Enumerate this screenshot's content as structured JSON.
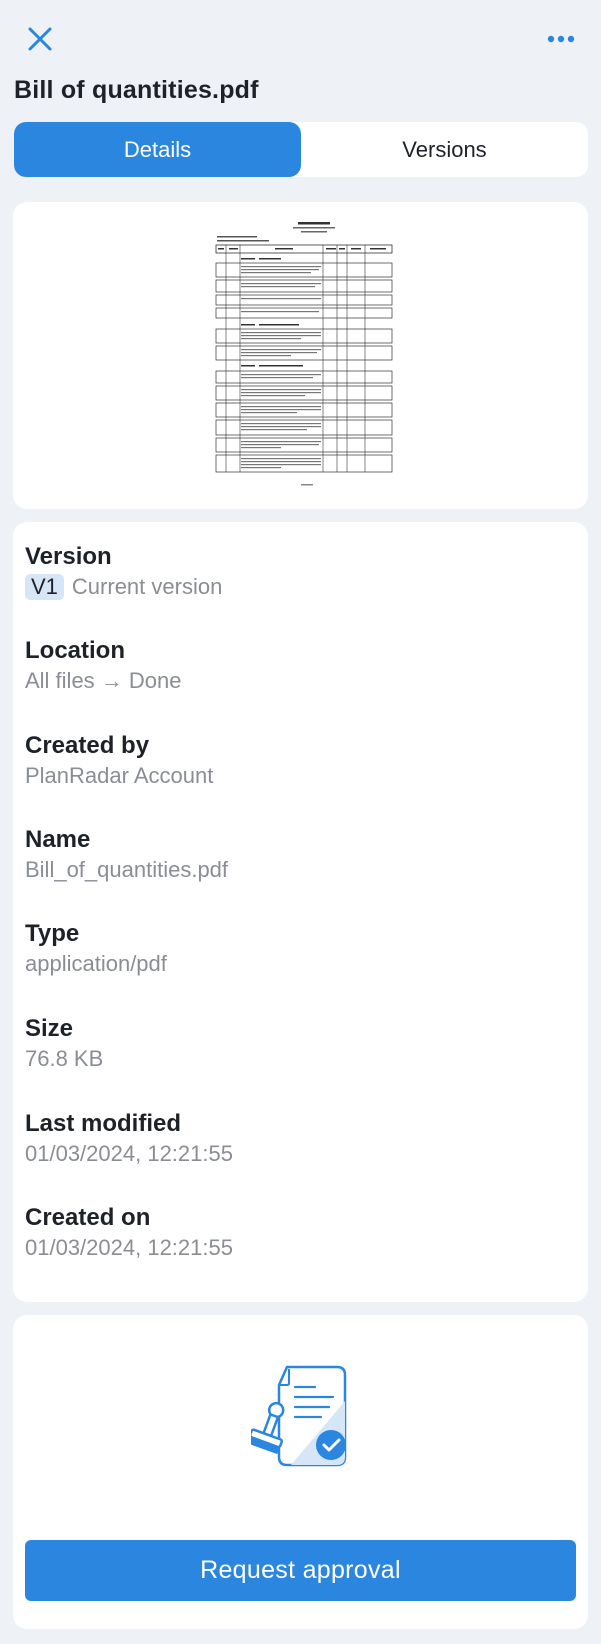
{
  "header": {
    "close_icon": "close-icon",
    "more_icon": "more-horizontal-icon",
    "title": "Bill of quantities.pdf"
  },
  "tabs": [
    {
      "label": "Details",
      "active": true
    },
    {
      "label": "Versions",
      "active": false
    }
  ],
  "preview": {
    "icon": "pdf-page-thumbnail",
    "alt": "PDF preview"
  },
  "details": {
    "version": {
      "label": "Version",
      "badge": "V1",
      "value": "Current version"
    },
    "location": {
      "label": "Location",
      "value": "All files → Done"
    },
    "created_by": {
      "label": "Created by",
      "value": "PlanRadar Account"
    },
    "name": {
      "label": "Name",
      "value": "Bill_of_quantities.pdf"
    },
    "type": {
      "label": "Type",
      "value": "application/pdf"
    },
    "size": {
      "label": "Size",
      "value": "76.8 KB"
    },
    "last_modified": {
      "label": "Last modified",
      "value": "01/03/2024, 12:21:55"
    },
    "created_on": {
      "label": "Created on",
      "value": "01/03/2024, 12:21:55"
    }
  },
  "approval": {
    "illustration_icon": "document-approval-stamp-icon",
    "button_label": "Request approval"
  },
  "colors": {
    "accent": "#2a86df",
    "background": "#eef2f7",
    "card": "#ffffff",
    "text_primary": "#1e2228",
    "text_secondary": "#8a8e94",
    "badge_bg": "#d6e6f7"
  }
}
